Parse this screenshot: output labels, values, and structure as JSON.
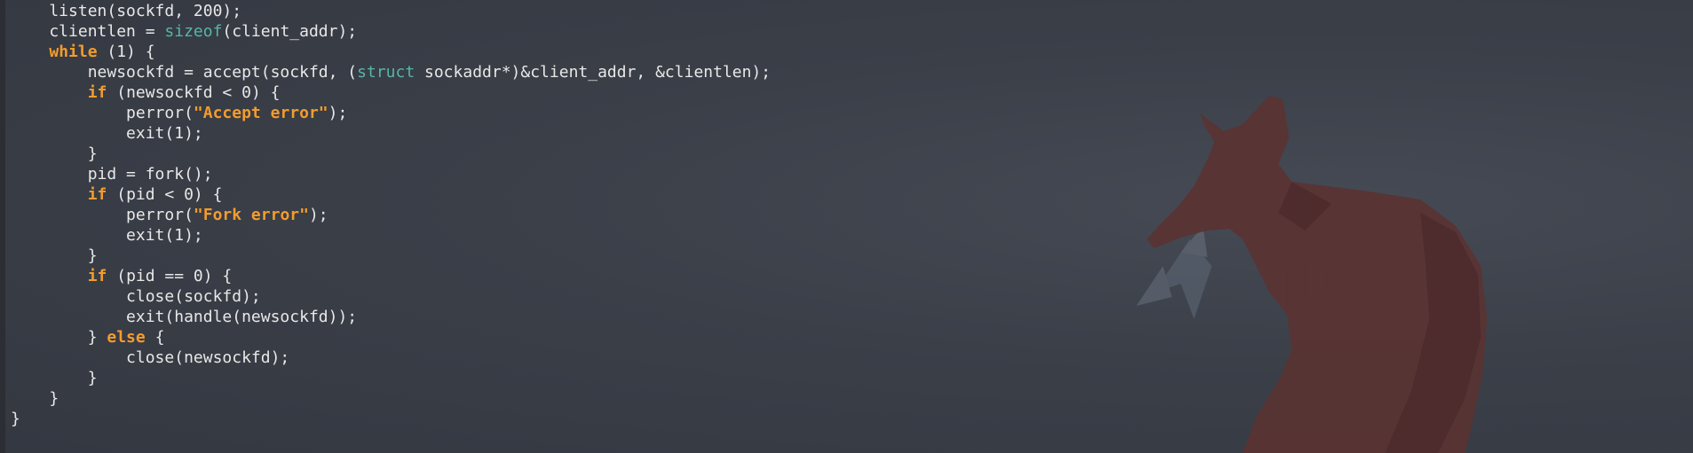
{
  "wallpaper": {
    "subject": "fox silhouette",
    "icon": "fox-silhouette-icon",
    "colors": {
      "background": "#3a3e46",
      "fox": "#5e3434",
      "brush": "#5f6a78"
    }
  },
  "theme": {
    "keyword_color": "#f39c2c",
    "string_color": "#f39c2c",
    "type_color": "#56b6a6",
    "text_color": "#e8e8e8"
  },
  "code": {
    "lines": [
      [
        [
          "plain",
          "    listen(sockfd, 200);"
        ]
      ],
      [
        [
          "plain",
          "    clientlen = "
        ],
        [
          "type",
          "sizeof"
        ],
        [
          "plain",
          "(client_addr);"
        ]
      ],
      [
        [
          "plain",
          "    "
        ],
        [
          "kw",
          "while"
        ],
        [
          "plain",
          " (1) {"
        ]
      ],
      [
        [
          "plain",
          "        newsockfd = accept(sockfd, ("
        ],
        [
          "type",
          "struct"
        ],
        [
          "plain",
          " sockaddr*)&client_addr, &clientlen);"
        ]
      ],
      [
        [
          "plain",
          "        "
        ],
        [
          "kw",
          "if"
        ],
        [
          "plain",
          " (newsockfd < 0) {"
        ]
      ],
      [
        [
          "plain",
          "            perror("
        ],
        [
          "str",
          "\"Accept error\""
        ],
        [
          "plain",
          ");"
        ]
      ],
      [
        [
          "plain",
          "            exit(1);"
        ]
      ],
      [
        [
          "plain",
          "        }"
        ]
      ],
      [
        [
          "plain",
          "        pid = fork();"
        ]
      ],
      [
        [
          "plain",
          "        "
        ],
        [
          "kw",
          "if"
        ],
        [
          "plain",
          " (pid < 0) {"
        ]
      ],
      [
        [
          "plain",
          "            perror("
        ],
        [
          "str",
          "\"Fork error\""
        ],
        [
          "plain",
          ");"
        ]
      ],
      [
        [
          "plain",
          "            exit(1);"
        ]
      ],
      [
        [
          "plain",
          "        }"
        ]
      ],
      [
        [
          "plain",
          "        "
        ],
        [
          "kw",
          "if"
        ],
        [
          "plain",
          " (pid == 0) {"
        ]
      ],
      [
        [
          "plain",
          "            close(sockfd);"
        ]
      ],
      [
        [
          "plain",
          "            exit(handle(newsockfd));"
        ]
      ],
      [
        [
          "plain",
          "        } "
        ],
        [
          "kw",
          "else"
        ],
        [
          "plain",
          " {"
        ]
      ],
      [
        [
          "plain",
          "            close(newsockfd);"
        ]
      ],
      [
        [
          "plain",
          "        }"
        ]
      ],
      [
        [
          "plain",
          "    }"
        ]
      ],
      [
        [
          "plain",
          "}"
        ]
      ]
    ]
  }
}
